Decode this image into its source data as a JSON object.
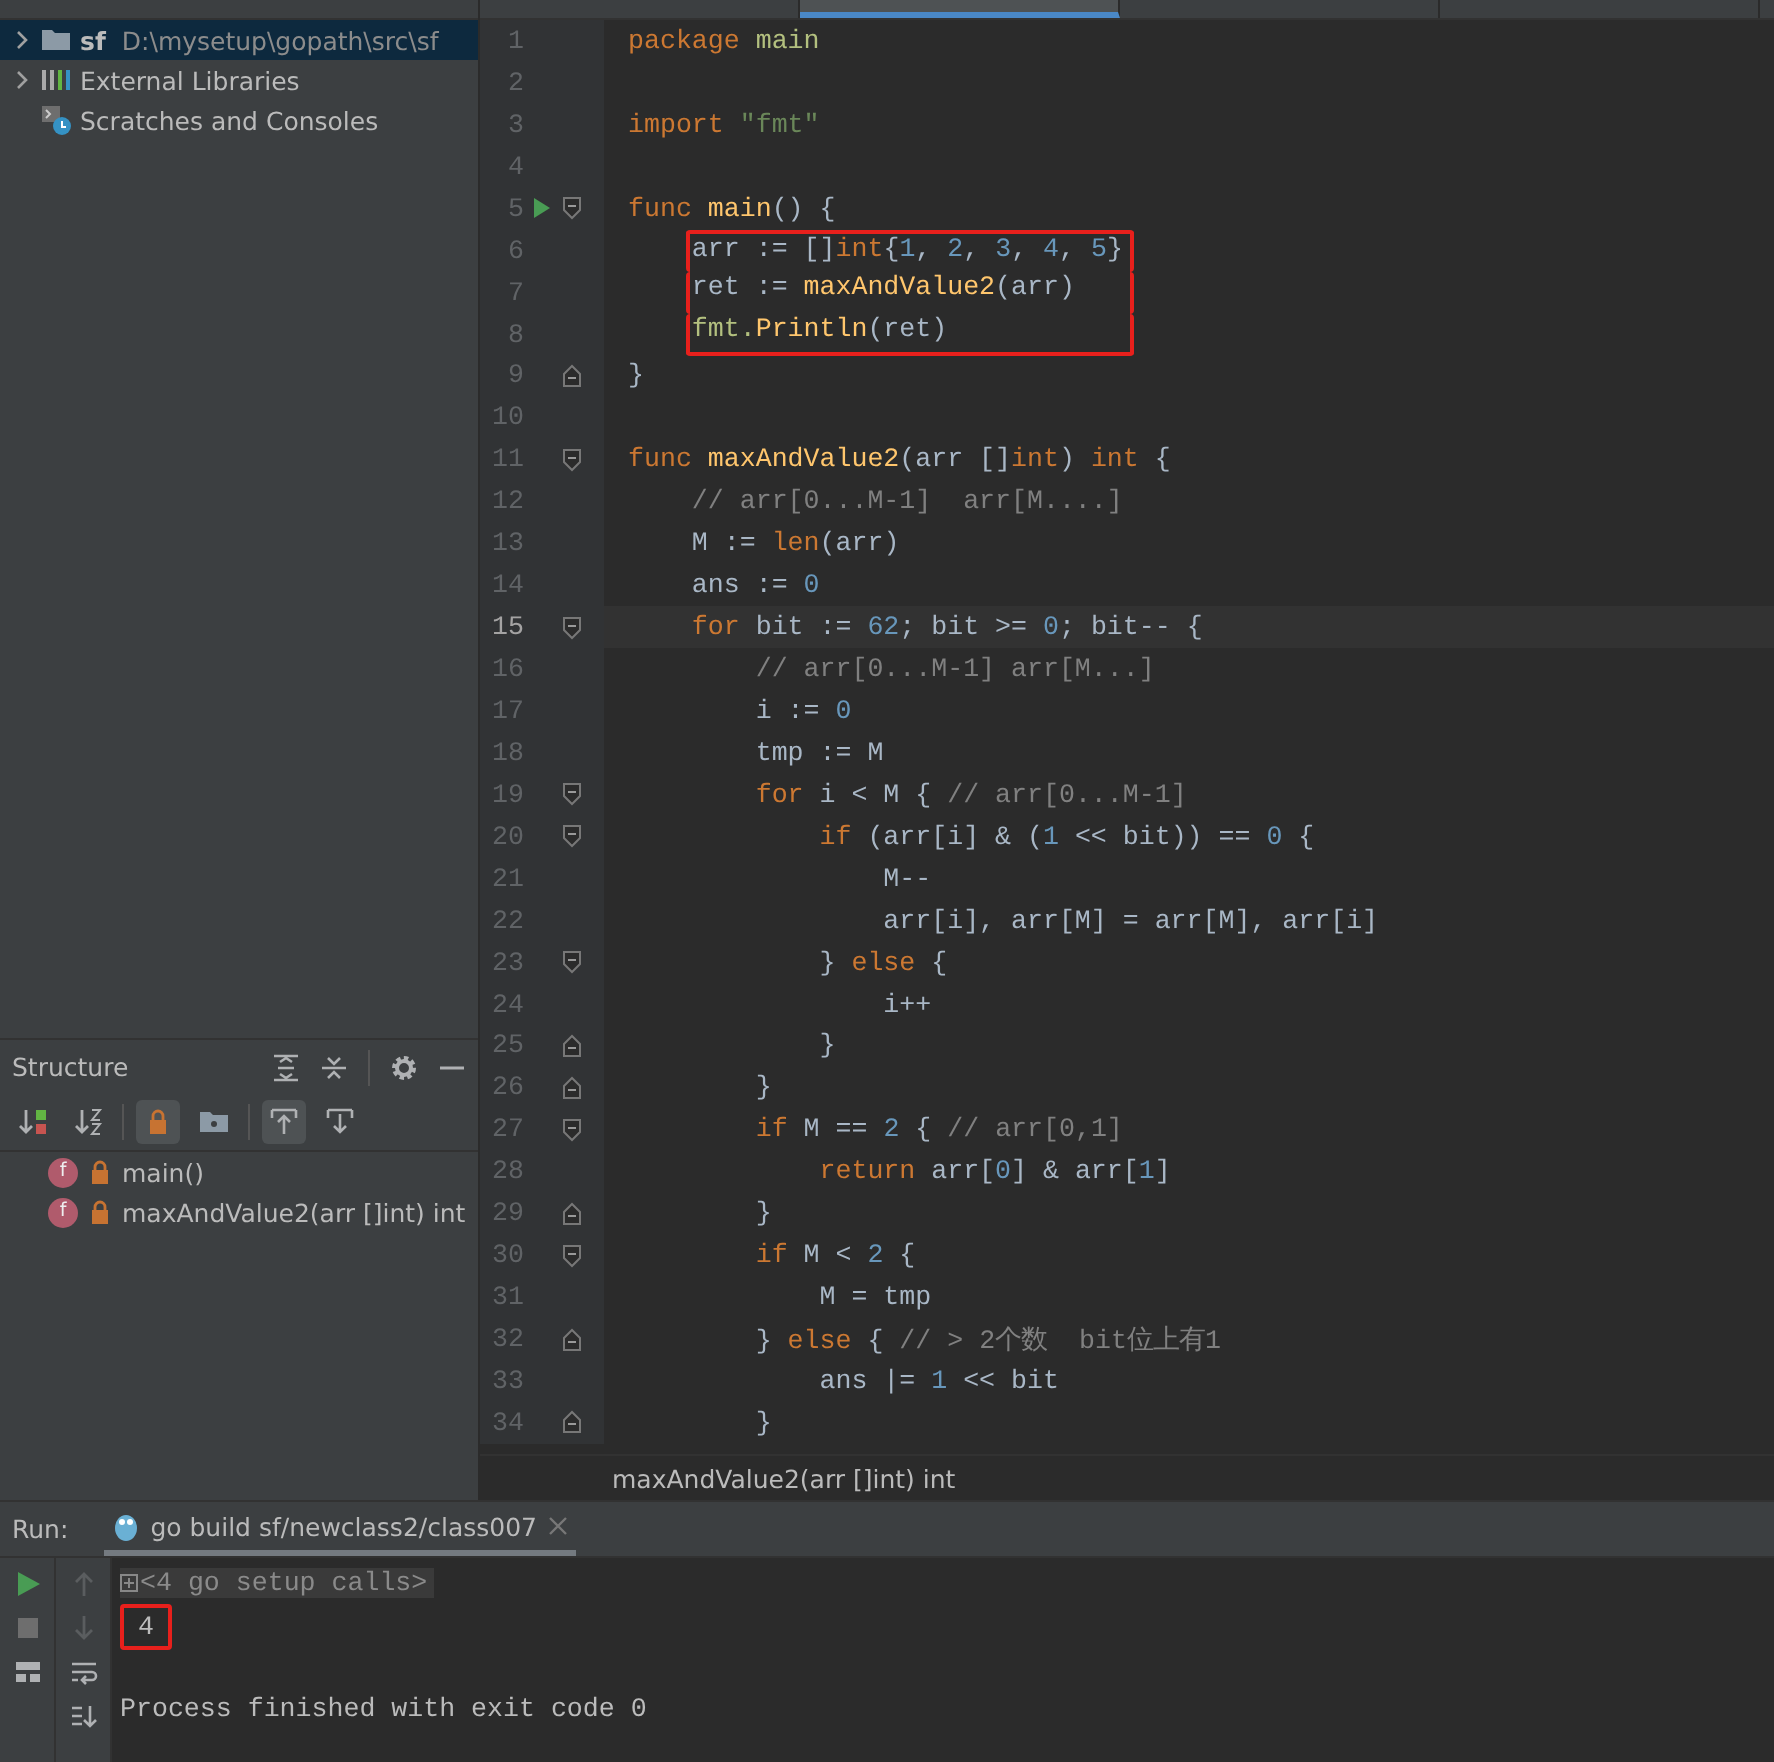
{
  "editor_tabs": [
    {
      "selected": false
    },
    {
      "selected": true
    },
    {
      "selected": false
    },
    {
      "selected": false
    }
  ],
  "project": {
    "items": [
      {
        "label": "sf",
        "path": "D:\\mysetup\\gopath\\src\\sf",
        "kind": "folder",
        "expandable": true,
        "selected": true
      },
      {
        "label": "External Libraries",
        "kind": "libraries",
        "expandable": true,
        "selected": false
      },
      {
        "label": "Scratches and Consoles",
        "kind": "scratches",
        "expandable": false,
        "selected": false
      }
    ]
  },
  "structure": {
    "title": "Structure",
    "items": [
      {
        "icon": "f",
        "label": "main()"
      },
      {
        "icon": "f",
        "label": "maxAndValue2(arr []int) int"
      }
    ]
  },
  "editor": {
    "lines": [
      {
        "number": "1",
        "tokens": [
          {
            "kind": "kw",
            "text": "package"
          },
          {
            "kind": "pkg",
            "text": " main"
          }
        ]
      },
      {
        "number": "2"
      },
      {
        "number": "3",
        "tokens": [
          {
            "kind": "kw",
            "text": "import"
          },
          {
            "kind": "str",
            "text": " \"fmt\""
          }
        ]
      },
      {
        "number": "4"
      },
      {
        "number": "5",
        "run_marker": true,
        "fold_start": true,
        "tokens": [
          {
            "kind": "kw",
            "text": "func"
          },
          {
            "kind": "fn",
            "text": " main"
          },
          {
            "kind": "plain",
            "text": "() {"
          }
        ]
      },
      {
        "number": "6",
        "boxed": true,
        "tokens": [
          {
            "kind": "plain",
            "text": "    arr := []"
          },
          {
            "kind": "kw",
            "text": "int"
          },
          {
            "kind": "plain",
            "text": "{"
          },
          {
            "kind": "num",
            "text": "1"
          },
          {
            "kind": "plain",
            "text": ", "
          },
          {
            "kind": "num",
            "text": "2"
          },
          {
            "kind": "plain",
            "text": ", "
          },
          {
            "kind": "num",
            "text": "3"
          },
          {
            "kind": "plain",
            "text": ", "
          },
          {
            "kind": "num",
            "text": "4"
          },
          {
            "kind": "plain",
            "text": ", "
          },
          {
            "kind": "num",
            "text": "5"
          },
          {
            "kind": "plain",
            "text": "}"
          }
        ]
      },
      {
        "number": "7",
        "boxed": true,
        "tokens": [
          {
            "kind": "plain",
            "text": "    ret := "
          },
          {
            "kind": "fn",
            "text": "maxAndValue2"
          },
          {
            "kind": "plain",
            "text": "(arr)"
          }
        ]
      },
      {
        "number": "8",
        "boxed": true,
        "tokens": [
          {
            "kind": "pkg",
            "text": "    fmt."
          },
          {
            "kind": "fn",
            "text": "Println"
          },
          {
            "kind": "plain",
            "text": "(ret)"
          }
        ]
      },
      {
        "number": "9",
        "fold_end": true,
        "tokens": [
          {
            "kind": "plain",
            "text": "}"
          }
        ]
      },
      {
        "number": "10"
      },
      {
        "number": "11",
        "fold_start": true,
        "tokens": [
          {
            "kind": "kw",
            "text": "func"
          },
          {
            "kind": "fn",
            "text": " maxAndValue2"
          },
          {
            "kind": "plain",
            "text": "(arr []"
          },
          {
            "kind": "kw",
            "text": "int"
          },
          {
            "kind": "plain",
            "text": ") "
          },
          {
            "kind": "kw",
            "text": "int"
          },
          {
            "kind": "plain",
            "text": " {"
          }
        ]
      },
      {
        "number": "12",
        "tokens": [
          {
            "kind": "cmt",
            "text": "    // arr[0...M-1]  arr[M....]"
          }
        ]
      },
      {
        "number": "13",
        "tokens": [
          {
            "kind": "plain",
            "text": "    M := "
          },
          {
            "kind": "kw",
            "text": "len"
          },
          {
            "kind": "plain",
            "text": "(arr)"
          }
        ]
      },
      {
        "number": "14",
        "tokens": [
          {
            "kind": "plain",
            "text": "    ans := "
          },
          {
            "kind": "num",
            "text": "0"
          }
        ]
      },
      {
        "number": "15",
        "current": true,
        "fold_start": true,
        "tokens": [
          {
            "kind": "kw",
            "text": "    for"
          },
          {
            "kind": "plain",
            "text": " bit := "
          },
          {
            "kind": "num",
            "text": "62"
          },
          {
            "kind": "plain",
            "text": "; bit >= "
          },
          {
            "kind": "num",
            "text": "0"
          },
          {
            "kind": "plain",
            "text": "; bit-- {"
          }
        ]
      },
      {
        "number": "16",
        "tokens": [
          {
            "kind": "cmt",
            "text": "        // arr[0...M-1] arr[M...]"
          }
        ]
      },
      {
        "number": "17",
        "tokens": [
          {
            "kind": "plain",
            "text": "        i := "
          },
          {
            "kind": "num",
            "text": "0"
          }
        ]
      },
      {
        "number": "18",
        "tokens": [
          {
            "kind": "plain",
            "text": "        tmp := M"
          }
        ]
      },
      {
        "number": "19",
        "fold_start": true,
        "tokens": [
          {
            "kind": "kw",
            "text": "        for"
          },
          {
            "kind": "plain",
            "text": " i < M { "
          },
          {
            "kind": "cmt",
            "text": "// arr[0...M-1]"
          }
        ]
      },
      {
        "number": "20",
        "fold_start": true,
        "tokens": [
          {
            "kind": "kw",
            "text": "            if"
          },
          {
            "kind": "plain",
            "text": " (arr[i] & ("
          },
          {
            "kind": "num",
            "text": "1"
          },
          {
            "kind": "plain",
            "text": " << bit)) == "
          },
          {
            "kind": "num",
            "text": "0"
          },
          {
            "kind": "plain",
            "text": " {"
          }
        ]
      },
      {
        "number": "21",
        "tokens": [
          {
            "kind": "plain",
            "text": "                M--"
          }
        ]
      },
      {
        "number": "22",
        "tokens": [
          {
            "kind": "plain",
            "text": "                arr[i], arr[M] = arr[M], arr[i]"
          }
        ]
      },
      {
        "number": "23",
        "fold_start": true,
        "tokens": [
          {
            "kind": "plain",
            "text": "            } "
          },
          {
            "kind": "kw",
            "text": "else"
          },
          {
            "kind": "plain",
            "text": " {"
          }
        ]
      },
      {
        "number": "24",
        "tokens": [
          {
            "kind": "plain",
            "text": "                i++"
          }
        ]
      },
      {
        "number": "25",
        "fold_end": true,
        "tokens": [
          {
            "kind": "plain",
            "text": "            }"
          }
        ]
      },
      {
        "number": "26",
        "fold_end": true,
        "tokens": [
          {
            "kind": "plain",
            "text": "        }"
          }
        ]
      },
      {
        "number": "27",
        "fold_start": true,
        "tokens": [
          {
            "kind": "kw",
            "text": "        if"
          },
          {
            "kind": "plain",
            "text": " M == "
          },
          {
            "kind": "num",
            "text": "2"
          },
          {
            "kind": "plain",
            "text": " { "
          },
          {
            "kind": "cmt",
            "text": "// arr[0,1]"
          }
        ]
      },
      {
        "number": "28",
        "tokens": [
          {
            "kind": "kw",
            "text": "            return"
          },
          {
            "kind": "plain",
            "text": " arr["
          },
          {
            "kind": "num",
            "text": "0"
          },
          {
            "kind": "plain",
            "text": "] & arr["
          },
          {
            "kind": "num",
            "text": "1"
          },
          {
            "kind": "plain",
            "text": "]"
          }
        ]
      },
      {
        "number": "29",
        "fold_end": true,
        "tokens": [
          {
            "kind": "plain",
            "text": "        }"
          }
        ]
      },
      {
        "number": "30",
        "fold_start": true,
        "tokens": [
          {
            "kind": "kw",
            "text": "        if"
          },
          {
            "kind": "plain",
            "text": " M < "
          },
          {
            "kind": "num",
            "text": "2"
          },
          {
            "kind": "plain",
            "text": " {"
          }
        ]
      },
      {
        "number": "31",
        "tokens": [
          {
            "kind": "plain",
            "text": "            M = tmp"
          }
        ]
      },
      {
        "number": "32",
        "fold_end": true,
        "tokens": [
          {
            "kind": "plain",
            "text": "        } "
          },
          {
            "kind": "kw",
            "text": "else"
          },
          {
            "kind": "plain",
            "text": " { "
          },
          {
            "kind": "cmt",
            "text": "// > 2个数  bit位上有1"
          }
        ]
      },
      {
        "number": "33",
        "tokens": [
          {
            "kind": "plain",
            "text": "            ans |= "
          },
          {
            "kind": "num",
            "text": "1"
          },
          {
            "kind": "plain",
            "text": " << bit"
          }
        ]
      },
      {
        "number": "34",
        "fold_end": true,
        "tokens": [
          {
            "kind": "plain",
            "text": "        }"
          }
        ]
      }
    ],
    "breadcrumb": "maxAndValue2(arr []int) int"
  },
  "run": {
    "label": "Run:",
    "tab": {
      "label": "go build sf/newclass2/class007",
      "selected": true
    },
    "output": [
      {
        "kind": "folded",
        "text": "<4 go setup calls>"
      },
      {
        "kind": "text",
        "text": "4",
        "boxed": true
      },
      {
        "kind": "blank"
      },
      {
        "kind": "text",
        "text": "Process finished with exit code 0"
      }
    ]
  }
}
